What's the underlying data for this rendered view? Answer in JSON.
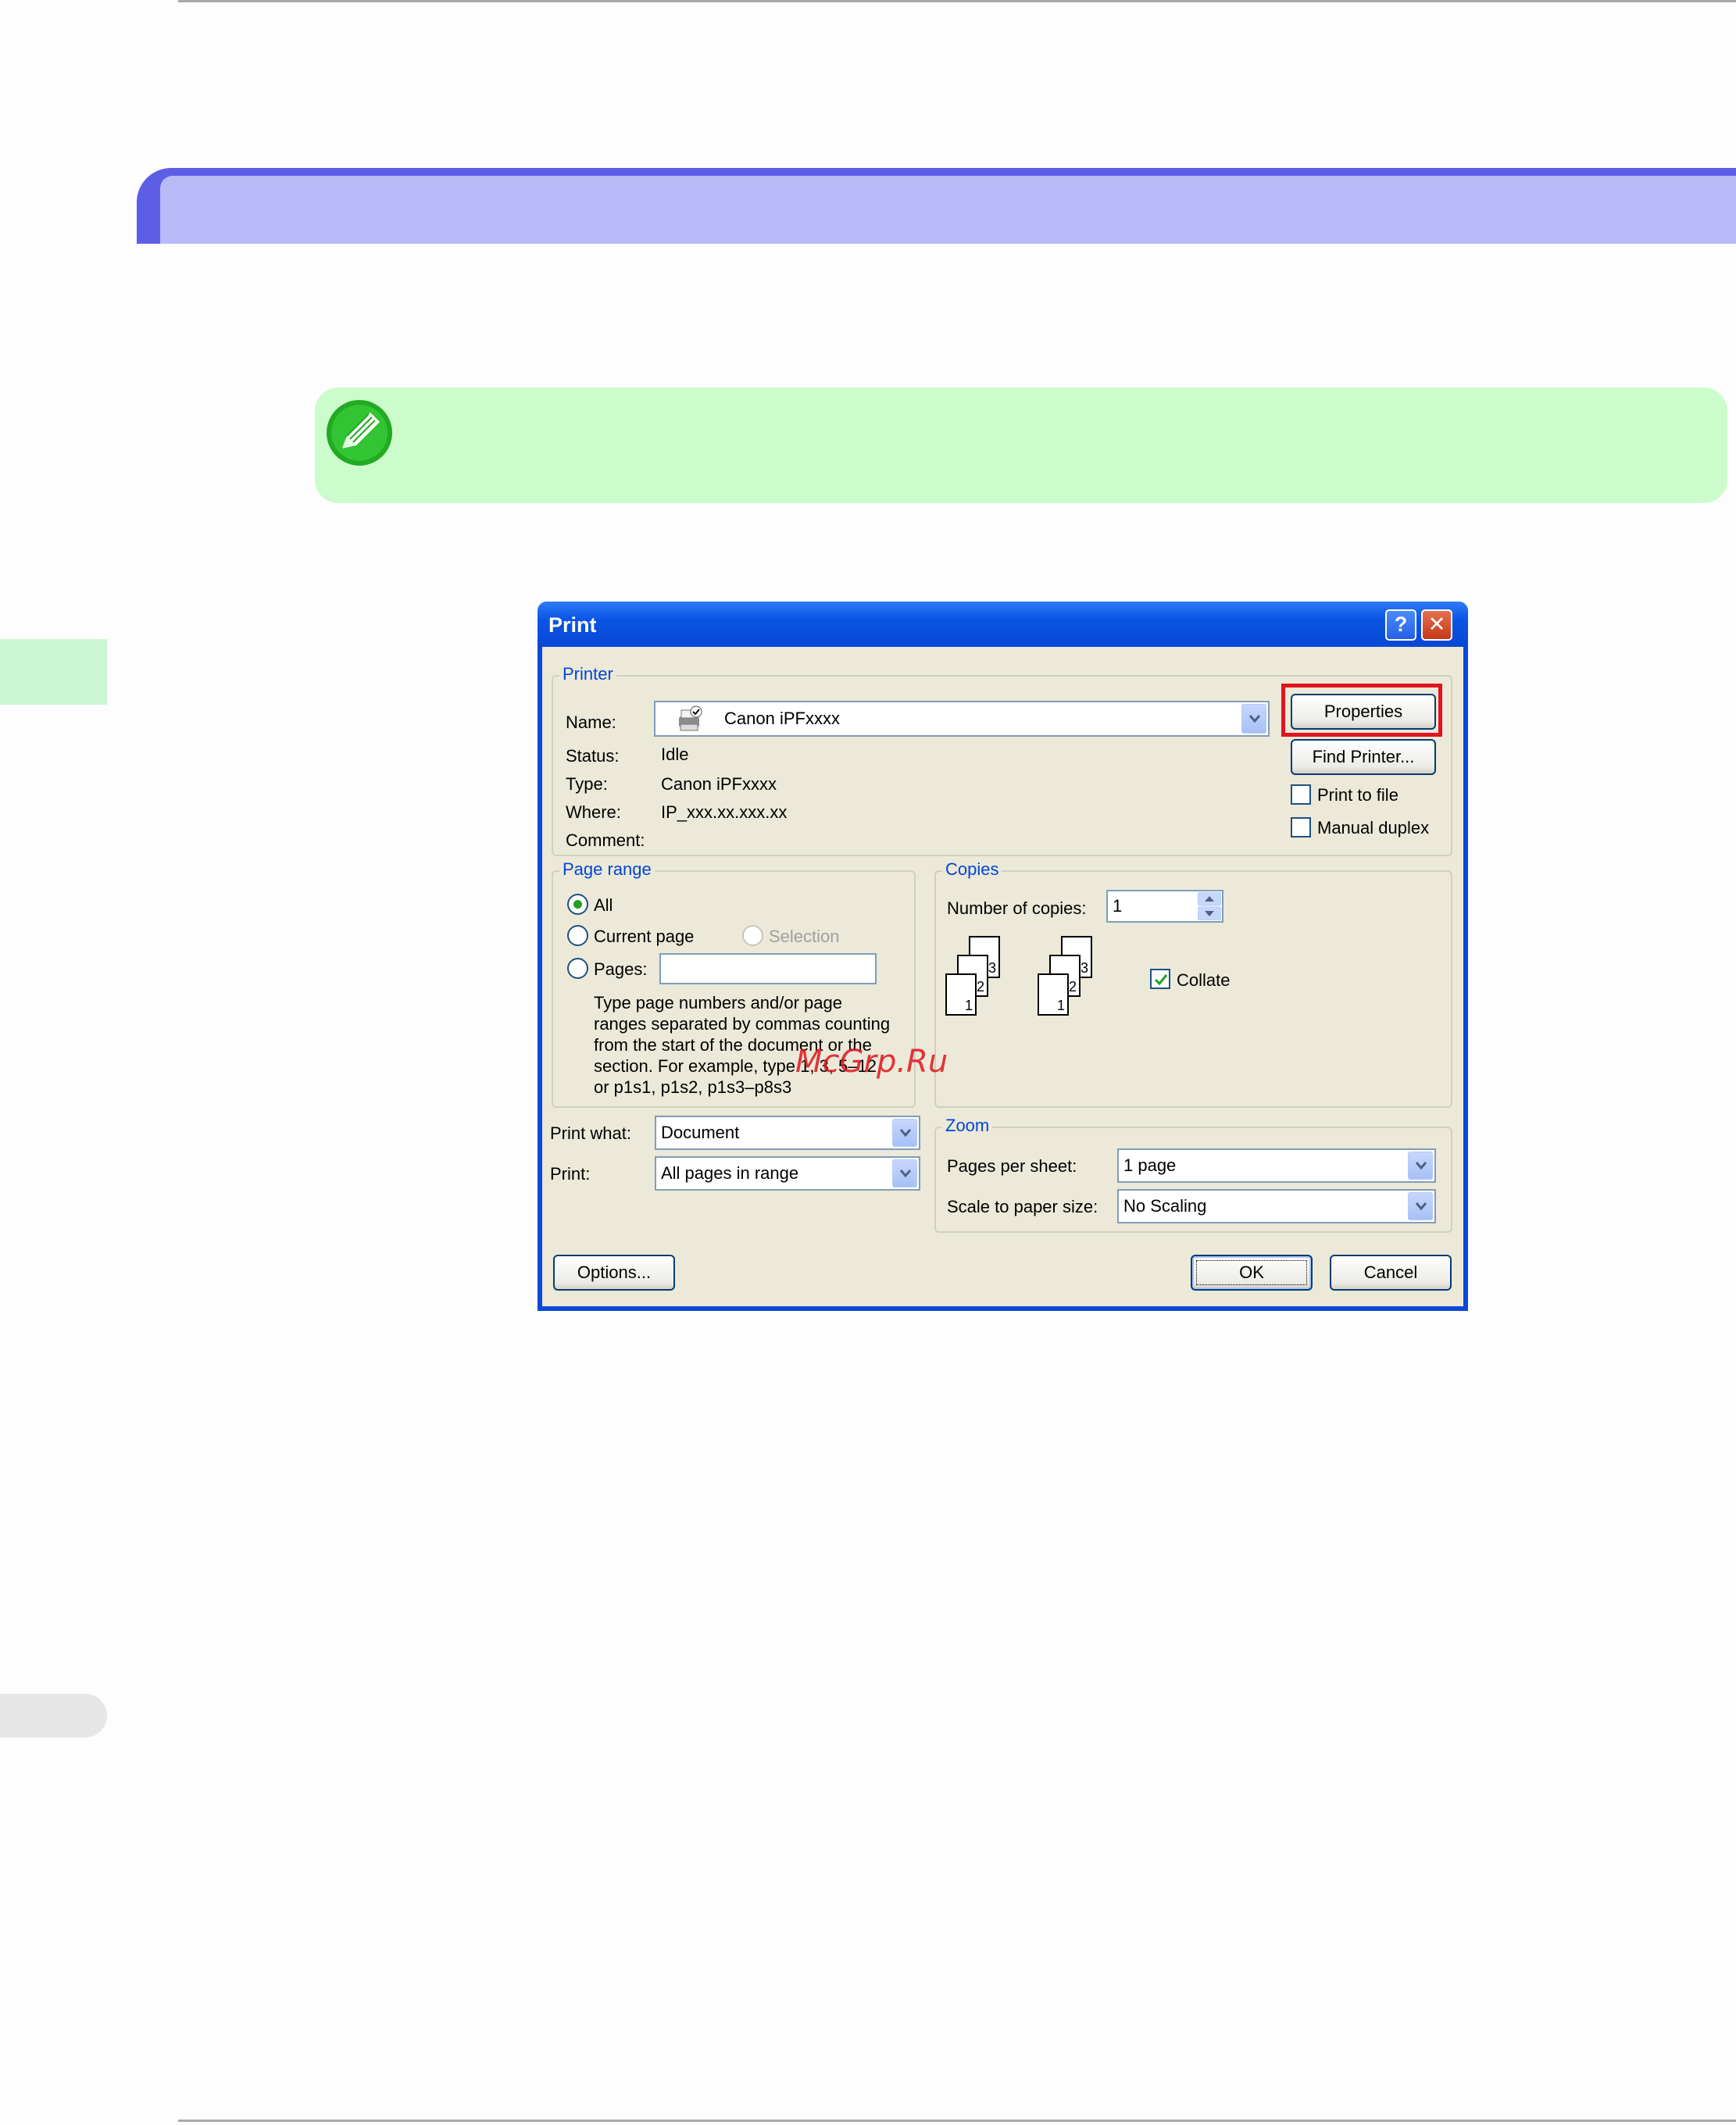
{
  "dialog": {
    "title": "Print",
    "help_glyph": "?",
    "close_glyph": "✕",
    "printer": {
      "group_title": "Printer",
      "name_label": "Name:",
      "name_value": "Canon iPFxxxx",
      "status_label": "Status:",
      "status_value": "Idle",
      "type_label": "Type:",
      "type_value": "Canon iPFxxxx",
      "where_label": "Where:",
      "where_value": "IP_xxx.xx.xxx.xx",
      "comment_label": "Comment:",
      "comment_value": "",
      "properties_button": "Properties",
      "find_printer_button": "Find Printer...",
      "print_to_file_label": "Print to file",
      "print_to_file_checked": false,
      "manual_duplex_label": "Manual duplex",
      "manual_duplex_checked": false
    },
    "page_range": {
      "group_title": "Page range",
      "all_label": "All",
      "current_page_label": "Current page",
      "selection_label": "Selection",
      "pages_label": "Pages:",
      "pages_value": "",
      "selected": "All",
      "help_lines": [
        "Type page numbers and/or page",
        "ranges separated by commas counting",
        "from the start of the document or the",
        "section. For example, type 1, 3, 5–12",
        "or p1s1, p1s2, p1s3–p8s3"
      ]
    },
    "copies": {
      "group_title": "Copies",
      "number_label": "Number of copies:",
      "number_value": "1",
      "collate_label": "Collate",
      "collate_checked": true,
      "sheet_numbers": [
        "3",
        "2",
        "1"
      ]
    },
    "print_what": {
      "label": "Print what:",
      "value": "Document"
    },
    "print": {
      "label": "Print:",
      "value": "All pages in range"
    },
    "zoom": {
      "group_title": "Zoom",
      "pages_per_sheet_label": "Pages per sheet:",
      "pages_per_sheet_value": "1 page",
      "scale_label": "Scale to paper size:",
      "scale_value": "No Scaling"
    },
    "options_button": "Options...",
    "ok_button": "OK",
    "cancel_button": "Cancel"
  },
  "watermark_text": "McGrp.Ru",
  "colors": {
    "section_band": "#5d5ee6",
    "note_background": "#ccfccc",
    "highlight_border": "#e0141e",
    "dialog_group_title": "#0046d5"
  },
  "icons": {
    "note": "pencil-note-icon",
    "printer": "printer-icon",
    "dropdown": "chevron-down-icon",
    "spinner": "spinner-icon"
  }
}
